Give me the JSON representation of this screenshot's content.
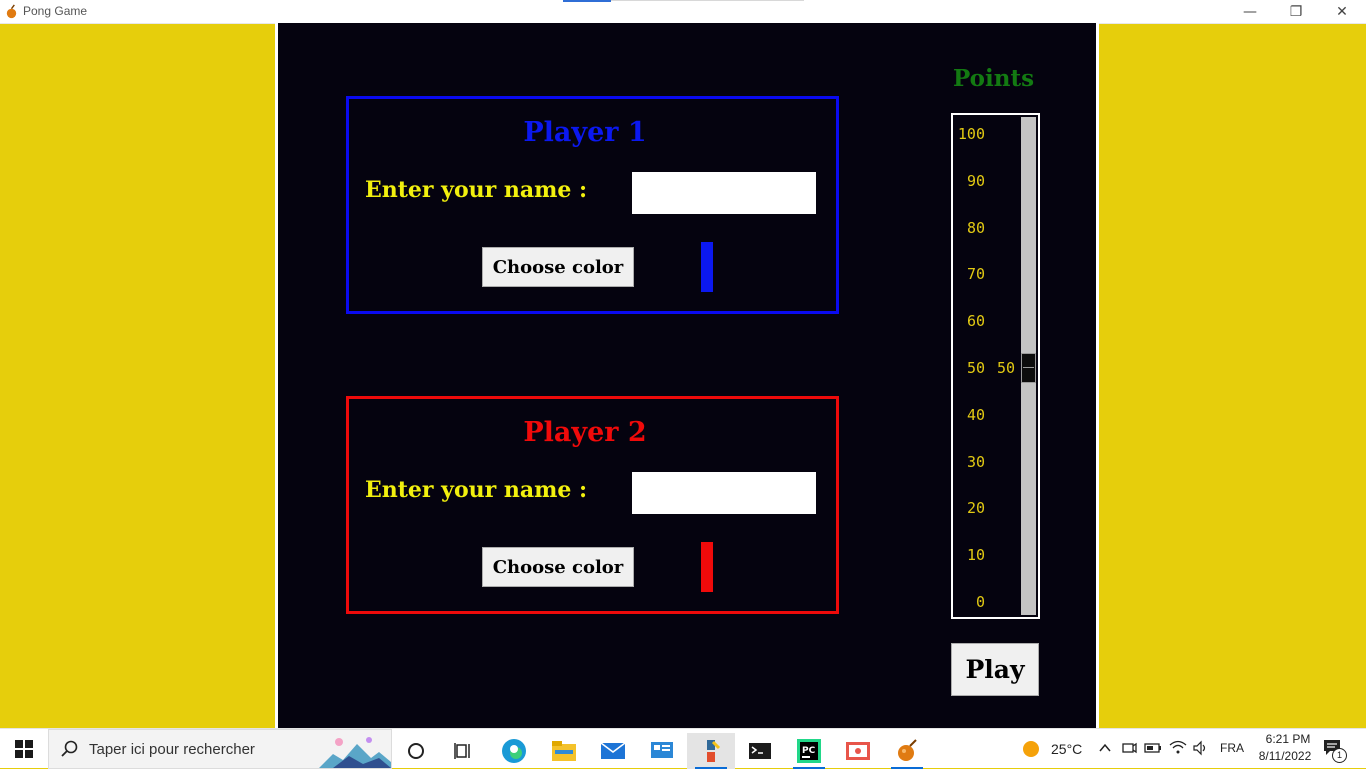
{
  "window": {
    "title": "Pong Game",
    "minimize_glyph": "—",
    "maximize_glyph": "❐",
    "close_glyph": "✕"
  },
  "player1": {
    "title": "Player 1",
    "name_label": "Enter your name :",
    "name_value": "",
    "color_button": "Choose color",
    "color": "#0b18f0"
  },
  "player2": {
    "title": "Player 2",
    "name_label": "Enter your name :",
    "name_value": "",
    "color_button": "Choose color",
    "color": "#f00a0a"
  },
  "points": {
    "title": "Points",
    "ticks": [
      "100",
      "90",
      "80",
      "70",
      "60",
      "50",
      "40",
      "30",
      "20",
      "10",
      "0"
    ],
    "min": 0,
    "max": 100,
    "value": 50,
    "value_label": "50"
  },
  "play_button": "Play",
  "colors": {
    "background": "#e6ce0c",
    "panel": "#05030f",
    "label": "#f2f00e",
    "points_title": "#137a12",
    "tick": "#e2c913"
  },
  "taskbar": {
    "search_placeholder": "Taper ici pour rechercher",
    "icons": [
      "windows-start-icon",
      "search-icon",
      "cortana-icon",
      "task-view-icon",
      "edge-icon",
      "file-explorer-icon",
      "mail-icon",
      "control-panel-icon",
      "python-idle-icon",
      "terminal-icon",
      "pycharm-icon",
      "screen-recorder-icon",
      "pong-game-icon"
    ],
    "weather": "25°C",
    "language": "FRA",
    "time": "6:21 PM",
    "date": "8/11/2022",
    "notifications": "1"
  }
}
